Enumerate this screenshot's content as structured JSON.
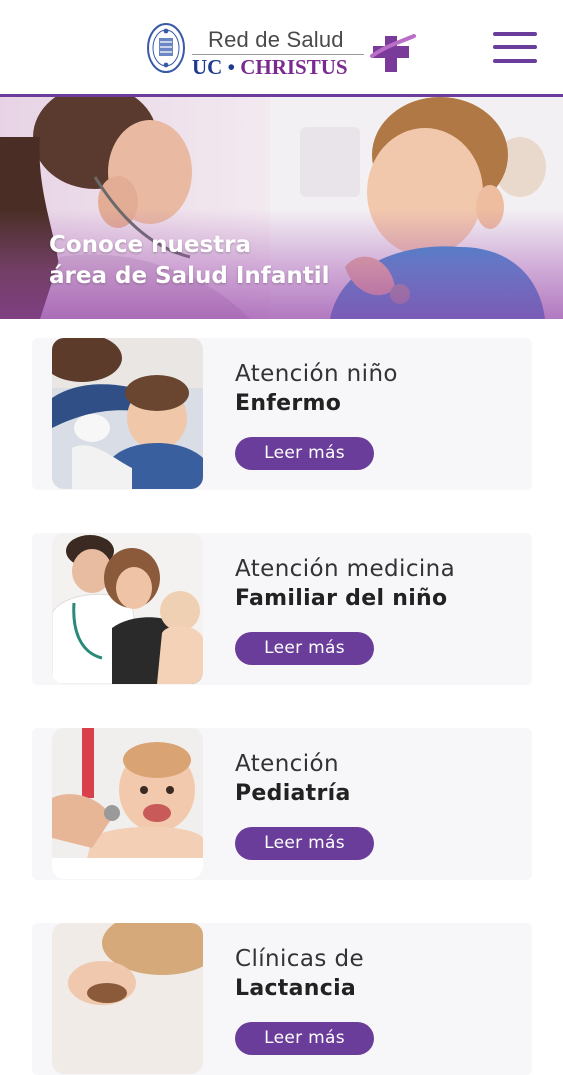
{
  "header": {
    "brand_line1": "Red de Salud",
    "brand_uc": "UC",
    "brand_dot": "•",
    "brand_christus": "CHRISTUS",
    "menu_icon": "hamburger-menu-icon"
  },
  "hero": {
    "title_line1": "Conoce nuestra",
    "title_line2": "área de Salud Infantil"
  },
  "cards": [
    {
      "line1": "Atención niño",
      "line2": "Enfermo",
      "button": "Leer más"
    },
    {
      "line1": "Atención medicina",
      "line2": "Familiar del niño",
      "button": "Leer más"
    },
    {
      "line1": "Atención",
      "line2": "Pediatría",
      "button": "Leer más"
    },
    {
      "line1": "Clínicas de",
      "line2": "Lactancia",
      "button": "Leer más"
    }
  ],
  "colors": {
    "brand_purple": "#6a3d9a",
    "brand_blue": "#1f3b8f",
    "card_background": "#f7f6f8"
  }
}
